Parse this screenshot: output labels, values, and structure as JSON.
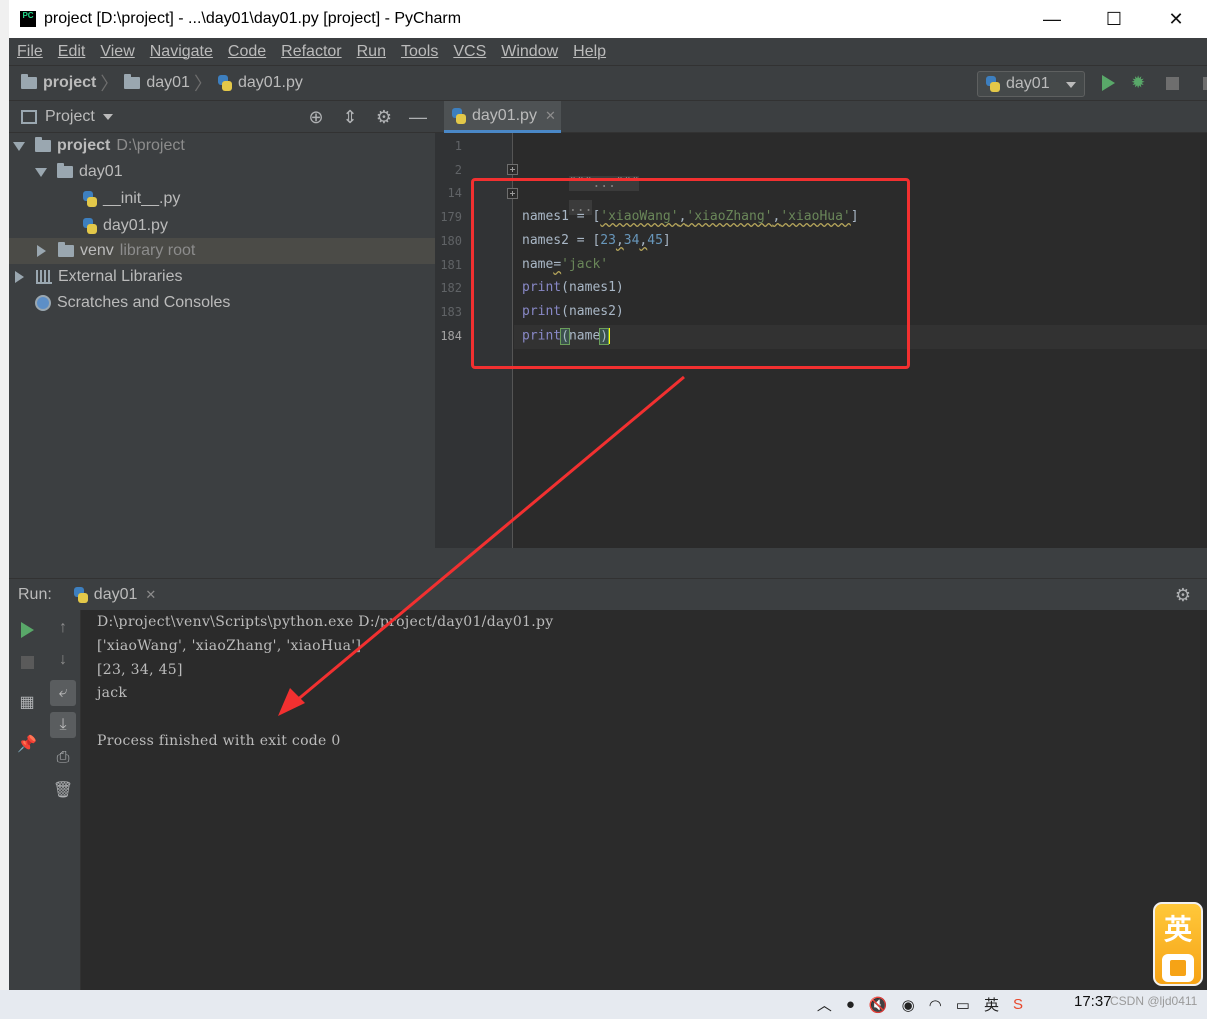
{
  "window": {
    "title": "project [D:\\project] - ...\\day01\\day01.py [project] - PyCharm",
    "app_icon_text": "PC",
    "controls": [
      "—",
      "☐",
      "✕"
    ]
  },
  "menu": [
    "File",
    "Edit",
    "View",
    "Navigate",
    "Code",
    "Refactor",
    "Run",
    "Tools",
    "VCS",
    "Window",
    "Help"
  ],
  "breadcrumb": {
    "project": "project",
    "folder": "day01",
    "file": "day01.py"
  },
  "run_config": {
    "name": "day01"
  },
  "project_panel": {
    "title": "Project",
    "tree": [
      {
        "name": "project",
        "extra": "D:\\project"
      },
      {
        "name": "day01"
      },
      {
        "name": "__init__.py"
      },
      {
        "name": "day01.py"
      },
      {
        "name": "venv",
        "extra": "library root"
      },
      {
        "name": "External Libraries"
      },
      {
        "name": "Scratches and Consoles"
      }
    ]
  },
  "editor": {
    "tab": "day01.py",
    "line_numbers": [
      "1",
      "2",
      "14",
      "179",
      "180",
      "181",
      "182",
      "183",
      "184"
    ],
    "folded_1": "\"\"\"...\"\"\"",
    "folded_2": "...",
    "l179": {
      "a": "names1 = [",
      "s1": "'xiaoWang'",
      "c1": ",",
      "s2": "'xiaoZhang'",
      "c2": ",",
      "s3": "'xiaoHua'",
      "z": "]"
    },
    "l180": {
      "a": "names2 = [",
      "n1": "23",
      "c1": ",",
      "n2": "34",
      "c2": ",",
      "n3": "45",
      "z": "]"
    },
    "l181": {
      "a": "name",
      "eq": "=",
      "s": "'jack'"
    },
    "l182": {
      "fn": "print",
      "arg": "(names1)"
    },
    "l183": {
      "fn": "print",
      "arg": "(names2)"
    },
    "l184": {
      "fn": "print",
      "open": "(",
      "arg": "name",
      "close": ")"
    }
  },
  "run_panel": {
    "label": "Run:",
    "tab": "day01",
    "output": [
      "D:\\project\\venv\\Scripts\\python.exe D:/project/day01/day01.py",
      "['xiaoWang', 'xiaoZhang', 'xiaoHua']",
      "[23, 34, 45]",
      "jack",
      "Process finished with exit code 0"
    ]
  },
  "ime": {
    "char": "英"
  },
  "taskbar": {
    "time": "17:37",
    "watermark": "CSDN @ljd0411",
    "ime_tray": "英"
  },
  "colors": {
    "annotation_red": "#f23030",
    "run_green": "#59a869",
    "tab_underline": "#4a88c7"
  }
}
